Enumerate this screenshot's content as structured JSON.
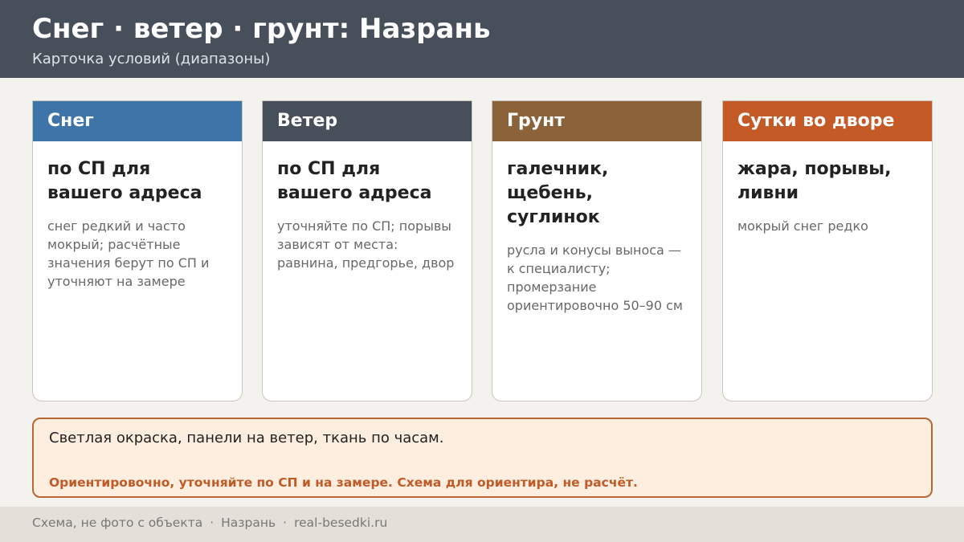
{
  "header": {
    "title": "Снег · ветер · грунт: Назрань",
    "subtitle": "Карточка условий (диапазоны)"
  },
  "cards": [
    {
      "title": "Снег",
      "value": "по СП для вашего адреса",
      "note": "снег редкий и часто мокрый; расчётные значения берут по СП и уточняют на замере",
      "color": "#3e74a8"
    },
    {
      "title": "Ветер",
      "value": "по СП для вашего адреса",
      "note": "уточняйте по СП; порывы зависят от места: равнина, предгорье, двор",
      "color": "#474f5a"
    },
    {
      "title": "Грунт",
      "value": "галечник, щебень, суглинок",
      "note": "русла и конусы выноса — к специалисту; промерзание ориентировочно 50–90 см",
      "color": "#8b6239"
    },
    {
      "title": "Сутки во дворе",
      "value": "жара, порывы, ливни",
      "note": "мокрый снег редко",
      "color": "#c45b27"
    }
  ],
  "note_box": {
    "main": "Светлая окраска, панели на ветер, ткань по часам.",
    "warning": "Ориентировочно, уточняйте по СП и на замере. Схема для ориентира, не расчёт."
  },
  "footer": {
    "left": "Схема, не фото с объекта",
    "separator": "·",
    "city": "Назрань",
    "site": "real-besedki.ru"
  },
  "colors": {
    "header_bg": "#474f5a",
    "page_bg": "#f4f2ee",
    "note_bg": "#fdeee0",
    "note_border": "#b96630",
    "warning_text": "#c05a26",
    "footer_bg": "#e4e0d9"
  }
}
